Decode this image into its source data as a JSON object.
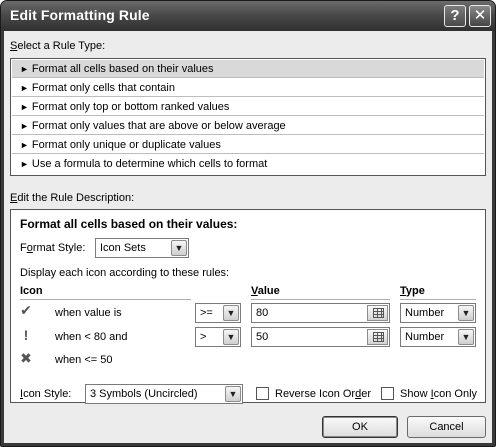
{
  "window": {
    "title": "Edit Formatting Rule",
    "help_glyph": "?",
    "close_glyph": "✕"
  },
  "rule_type": {
    "label_key": "S",
    "label_rest": "elect a Rule Type:",
    "items": [
      {
        "label": "Format all cells based on their values",
        "selected": true
      },
      {
        "label": "Format only cells that contain",
        "selected": false
      },
      {
        "label": "Format only top or bottom ranked values",
        "selected": false
      },
      {
        "label": "Format only values that are above or below average",
        "selected": false
      },
      {
        "label": "Format only unique or duplicate values",
        "selected": false
      },
      {
        "label": "Use a formula to determine which cells to format",
        "selected": false
      }
    ],
    "arrow_glyph": "►"
  },
  "description": {
    "label_key": "E",
    "label_rest": "dit the Rule Description:",
    "heading": "Format all cells based on their values:",
    "format_style": {
      "label_pre": "F",
      "label_key": "o",
      "label_rest": "rmat Style:",
      "value": "Icon Sets"
    },
    "display_text": "Display each icon according to these rules:",
    "columns": {
      "icon": "Icon",
      "value_key": "V",
      "value_rest": "alue",
      "type_key": "T",
      "type_rest": "ype"
    },
    "rules": [
      {
        "icon": "checkmark-icon",
        "glyph": "✔",
        "condition": "when value is",
        "operator": ">=",
        "value": "80",
        "type": "Number"
      },
      {
        "icon": "exclamation-icon",
        "glyph": "!",
        "condition": "when < 80 and",
        "operator": ">",
        "value": "50",
        "type": "Number"
      },
      {
        "icon": "cross-icon",
        "glyph": "✖",
        "condition": "when <= 50"
      }
    ],
    "icon_style": {
      "label_key": "I",
      "label_rest": "con Style:",
      "value": "3 Symbols (Uncircled)"
    },
    "reverse_order": {
      "label_pre": "Reverse Icon Or",
      "label_key": "d",
      "label_rest": "er",
      "checked": false
    },
    "show_icon_only": {
      "label_pre": "Show ",
      "label_key": "I",
      "label_rest": "con Only",
      "checked": false
    }
  },
  "buttons": {
    "ok": "OK",
    "cancel": "Cancel"
  },
  "dropdown_glyph": "▼"
}
